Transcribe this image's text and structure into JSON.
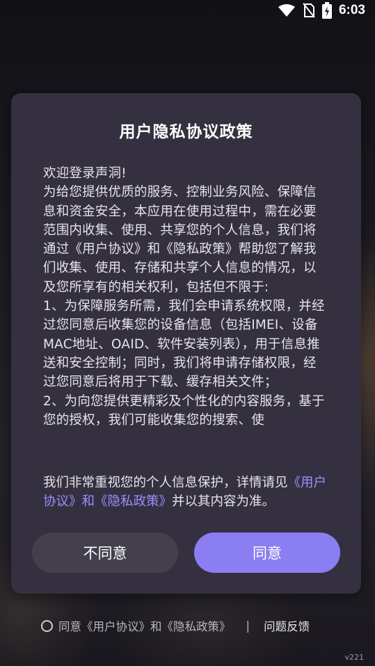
{
  "status_bar": {
    "time": "6:03",
    "icons": [
      "wifi-icon",
      "no-sim-icon",
      "battery-charging-icon"
    ]
  },
  "dialog": {
    "title": "用户隐私协议政策",
    "body_paragraphs": [
      "欢迎登录声洞!",
      " 为给您提供优质的服务、控制业务风险、保障信息和资金安全，本应用在使用过程中，需在必要范围内收集、使用、共享您的个人信息，我们将通过《用户协议》和《隐私政策》帮助您了解我们收集、使用、存储和共享个人信息的情况，以及您所享有的相关权利，包括但不限于:",
      "1、为保障服务所需，我们会申请系统权限，并经过您同意后收集您的设备信息（包括IMEI、设备MAC地址、OAID、软件安装列表），用于信息推送和安全控制；同时，我们将申请存储权限，经过您同意后将用于下载、缓存相关文件；",
      "2、为向您提供更精彩及个性化的内容服务，基于您的授权，我们可能收集您的搜索、使"
    ],
    "footer_prefix": "我们非常重视您的个人信息保护，详情请见",
    "footer_link": "《用户协议》和《隐私政策》",
    "footer_suffix": "并以其内容为准。",
    "disagree_label": "不同意",
    "agree_label": "同意"
  },
  "bottom": {
    "agree_prefix": "同意",
    "user_agreement": "《用户协议》",
    "and": "和",
    "privacy_policy": "《隐私政策》",
    "separator": "|",
    "feedback": "问题反馈"
  },
  "version": "v221",
  "colors": {
    "dialog_bg": "#35303f",
    "accent": "#8b7df2",
    "link": "#9d8cff"
  }
}
